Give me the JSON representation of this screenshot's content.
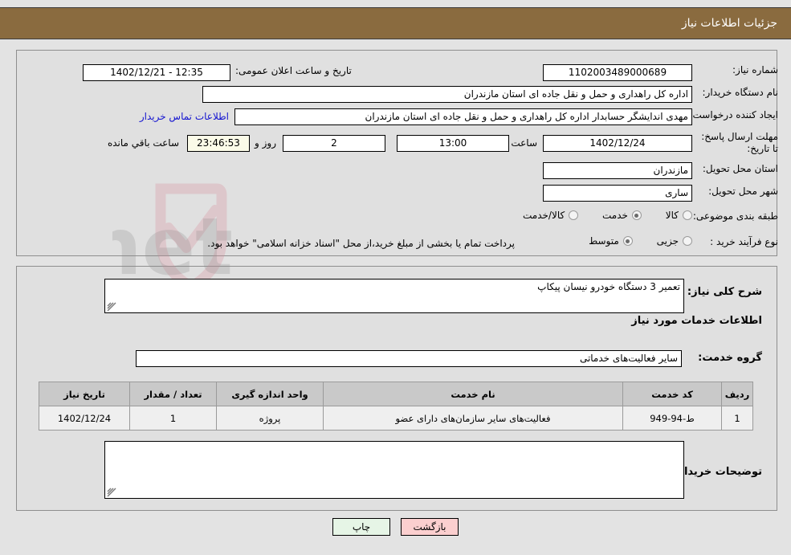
{
  "header": {
    "title": "جزئیات اطلاعات نیاز",
    "bg_color": "#8a6b3f"
  },
  "watermark": {
    "text": "AriaTender.net"
  },
  "top_panel": {
    "need_number_label": "شماره نیاز:",
    "need_number_value": "1102003489000689",
    "announce_label": "تاریخ و ساعت اعلان عمومی:",
    "announce_value": "12:35 - 1402/12/21",
    "buyer_org_label": "نام دستگاه خریدار:",
    "buyer_org_value": "اداره کل راهداری و حمل و نقل جاده ای استان مازندران",
    "creator_label": "ایجاد کننده درخواست:",
    "creator_value": "مهدی اندایشگر حسابدار اداره کل راهداری و حمل و نقل جاده ای استان مازندران",
    "contact_link": "اطلاعات تماس خریدار",
    "deadline_label": "مهلت ارسال پاسخ: تا تاریخ:",
    "deadline_date": "1402/12/24",
    "hour_label": "ساعت",
    "deadline_time": "13:00",
    "days_value": "2",
    "days_label": "روز و",
    "countdown_value": "23:46:53",
    "remaining_label": "ساعت باقي مانده",
    "province_label": "استان محل تحویل:",
    "province_value": "مازندران",
    "city_label": "شهر محل تحویل:",
    "city_value": "ساری",
    "category_label": "طبقه بندی موضوعی:",
    "category_options": [
      {
        "label": "کالا",
        "selected": false
      },
      {
        "label": "خدمت",
        "selected": true
      },
      {
        "label": "کالا/خدمت",
        "selected": false
      }
    ],
    "process_label": "نوع فرآیند خرید :",
    "process_options": [
      {
        "label": "جزیی",
        "selected": false
      },
      {
        "label": "متوسط",
        "selected": true
      }
    ],
    "payment_note": "پرداخت تمام یا بخشی از مبلغ خرید،از محل \"اسناد خزانه اسلامی\" خواهد بود."
  },
  "bottom_panel": {
    "general_desc_label": "شرح کلی نیاز:",
    "general_desc_value": "تعمیر 3 دستگاه خودرو نیسان پیکاپ",
    "services_heading": "اطلاعات خدمات مورد نیاز",
    "service_group_label": "گروه خدمت:",
    "service_group_value": "سایر فعالیت‌های خدماتی",
    "buyer_notes_label": "توضیحات خریدار:",
    "buyer_notes_value": ""
  },
  "table": {
    "headers": [
      "ردیف",
      "کد خدمت",
      "نام خدمت",
      "واحد اندازه گیری",
      "تعداد / مقدار",
      "تاریخ نیاز"
    ],
    "rows": [
      {
        "index": "1",
        "service_code": "ط-94-949",
        "service_name": "فعالیت‌های سایر سازمان‌های دارای عضو",
        "unit": "پروژه",
        "quantity": "1",
        "need_date": "1402/12/24"
      }
    ]
  },
  "buttons": {
    "print": "چاپ",
    "back": "بازگشت"
  }
}
